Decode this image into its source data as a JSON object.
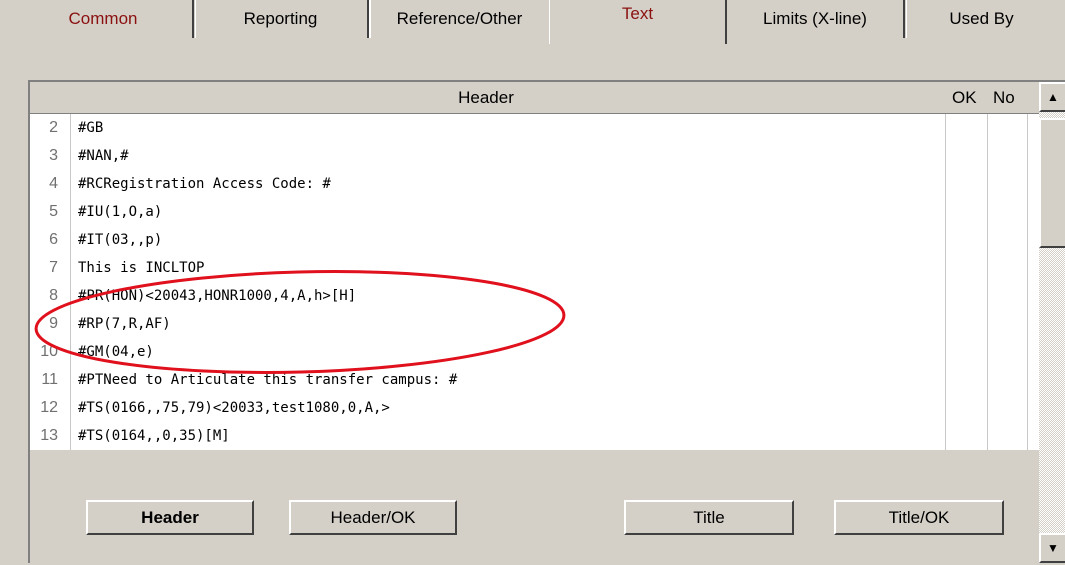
{
  "tabs": [
    {
      "label": "Common"
    },
    {
      "label": "Reporting"
    },
    {
      "label": "Reference/Other"
    },
    {
      "label": "Text"
    },
    {
      "label": "Limits (X-line)"
    },
    {
      "label": "Used By"
    }
  ],
  "grid": {
    "header": {
      "title": "Header",
      "ok": "OK",
      "no": "No"
    },
    "rows": [
      {
        "num": "2",
        "code": "#GB"
      },
      {
        "num": "3",
        "code": "#NAN,#"
      },
      {
        "num": "4",
        "code": "#RCRegistration Access Code: #"
      },
      {
        "num": "5",
        "code": "#IU(1,O,a)"
      },
      {
        "num": "6",
        "code": "#IT(03,,p)"
      },
      {
        "num": "7",
        "code": "This is INCLTOP"
      },
      {
        "num": "8",
        "code": "#PR(HON)<20043,HONR1000,4,A,h>[H]"
      },
      {
        "num": "9",
        "code": "#RP(7,R,AF)"
      },
      {
        "num": "10",
        "code": "#GM(04,e)"
      },
      {
        "num": "11",
        "code": "#PTNeed to Articulate this transfer campus: #"
      },
      {
        "num": "12",
        "code": "#TS(0166,,75,79)<20033,test1080,0,A,>"
      },
      {
        "num": "13",
        "code": "#TS(0164,,0,35)[M]"
      }
    ]
  },
  "buttons": {
    "header": "Header",
    "header_ok": "Header/OK",
    "title": "Title",
    "title_ok": "Title/OK"
  },
  "colors": {
    "active_tab_text": "#8b1010",
    "annotation": "#e0101c"
  },
  "icons": {
    "scroll_up": "triangle-up",
    "scroll_down": "triangle-down"
  }
}
